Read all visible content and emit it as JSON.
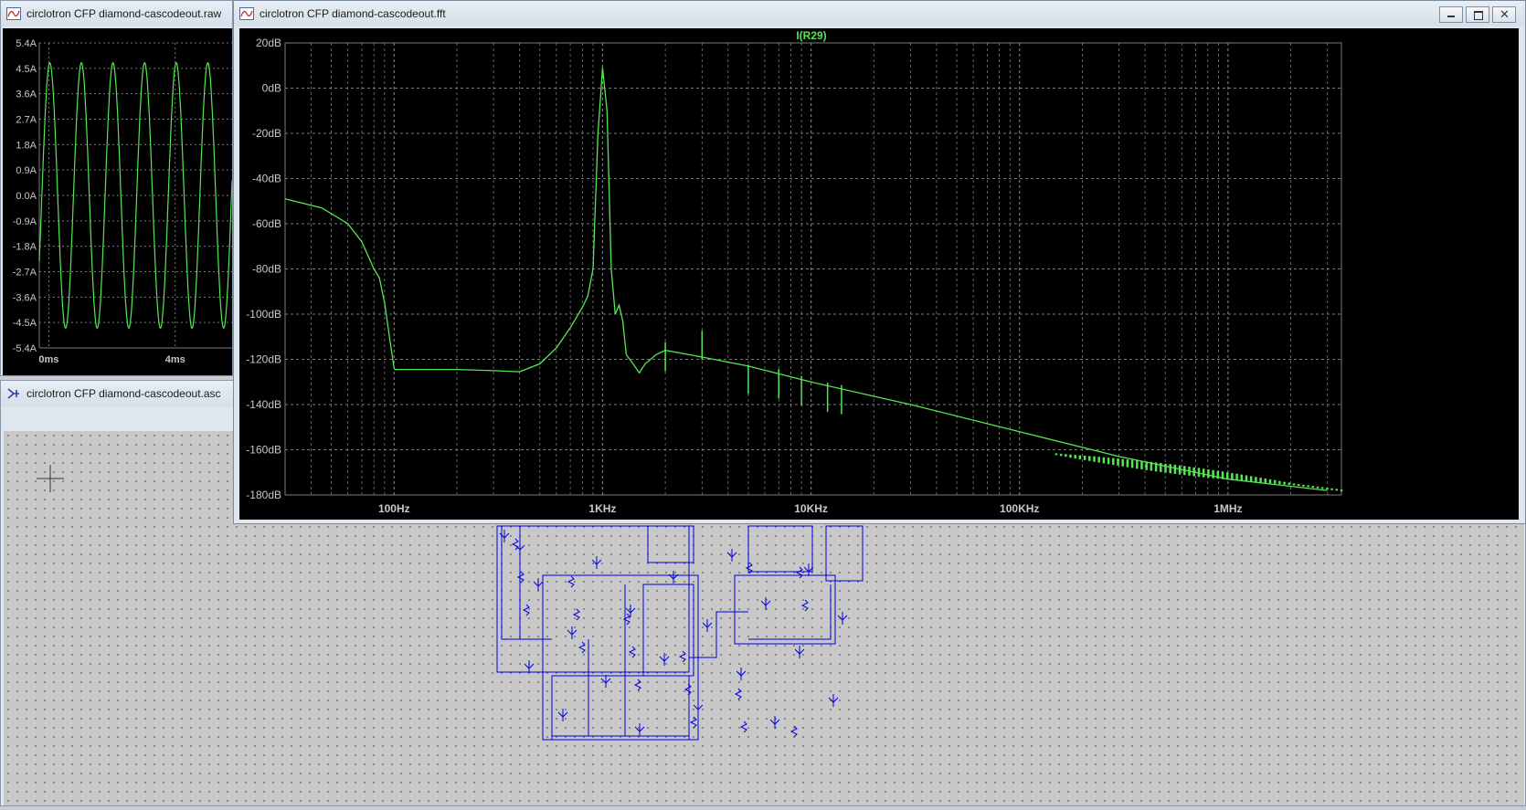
{
  "windows": {
    "raw": {
      "title": "circlotron CFP diamond-cascodeout.raw"
    },
    "fft": {
      "title": "circlotron CFP diamond-cascodeout.fft",
      "trace": "I(R29)"
    },
    "asc": {
      "title": "circlotron CFP diamond-cascodeout.asc"
    }
  },
  "colors": {
    "trace": "#55e655",
    "grid": "#7a7a7a",
    "label": "#c8c8c8",
    "schematic_wire": "#0000dd"
  },
  "icons": {
    "raw": "waveform-icon",
    "fft": "waveform-icon",
    "asc": "schematic-icon"
  },
  "chart_data": [
    {
      "type": "line",
      "title": "",
      "xlabel": "",
      "ylabel": "",
      "y_ticks": [
        "5.4A",
        "4.5A",
        "3.6A",
        "2.7A",
        "1.8A",
        "0.9A",
        "0.0A",
        "-0.9A",
        "-1.8A",
        "-2.7A",
        "-3.6A",
        "-4.5A",
        "-5.4A"
      ],
      "x_ticks": [
        "0ms",
        "4ms"
      ],
      "ylim": [
        -5.4,
        5.4
      ],
      "xlim_ms": [
        -0.3,
        5.8
      ],
      "series": [
        {
          "amplitude": 4.7,
          "frequency_hz": 1000
        }
      ]
    },
    {
      "type": "line",
      "title": "I(R29)",
      "xlabel": "",
      "ylabel": "",
      "x_scale": "log",
      "xlim_hz": [
        30,
        3500000
      ],
      "ylim_db": [
        -180,
        20
      ],
      "y_ticks": [
        "20dB",
        "0dB",
        "-20dB",
        "-40dB",
        "-60dB",
        "-80dB",
        "-100dB",
        "-120dB",
        "-140dB",
        "-160dB",
        "-180dB"
      ],
      "x_ticks": [
        "100Hz",
        "1KHz",
        "10KHz",
        "100KHz",
        "1MHz"
      ],
      "series": [
        {
          "name": "I(R29)",
          "x": [
            30,
            45,
            60,
            70,
            80,
            85,
            90,
            95,
            100,
            101,
            200,
            300,
            400,
            500,
            600,
            700,
            800,
            850,
            900,
            950,
            1000,
            1050,
            1100,
            1150,
            1200,
            1250,
            1300,
            1400,
            1500,
            1600,
            1700,
            1800,
            2000,
            3000,
            5000,
            10000,
            30000,
            100000,
            300000,
            1000000,
            3000000
          ],
          "y": [
            -49,
            -53,
            -60,
            -68,
            -80,
            -84,
            -95,
            -110,
            -124,
            -124.5,
            -124.5,
            -125,
            -125.5,
            -122,
            -115,
            -106,
            -97,
            -92,
            -80,
            -20,
            9,
            -10,
            -80,
            -100,
            -96,
            -103,
            -118,
            -122,
            -126,
            -122,
            -120,
            -118,
            -116,
            -119,
            -123,
            -130,
            -140,
            -152,
            -163,
            -173,
            -178
          ]
        }
      ],
      "harmonics_hz": [
        2000,
        3000,
        5000,
        7000,
        9000,
        12000,
        14000
      ],
      "harmonics_db": [
        -118,
        -113,
        -128,
        -130,
        -133,
        -136,
        -137
      ]
    }
  ]
}
